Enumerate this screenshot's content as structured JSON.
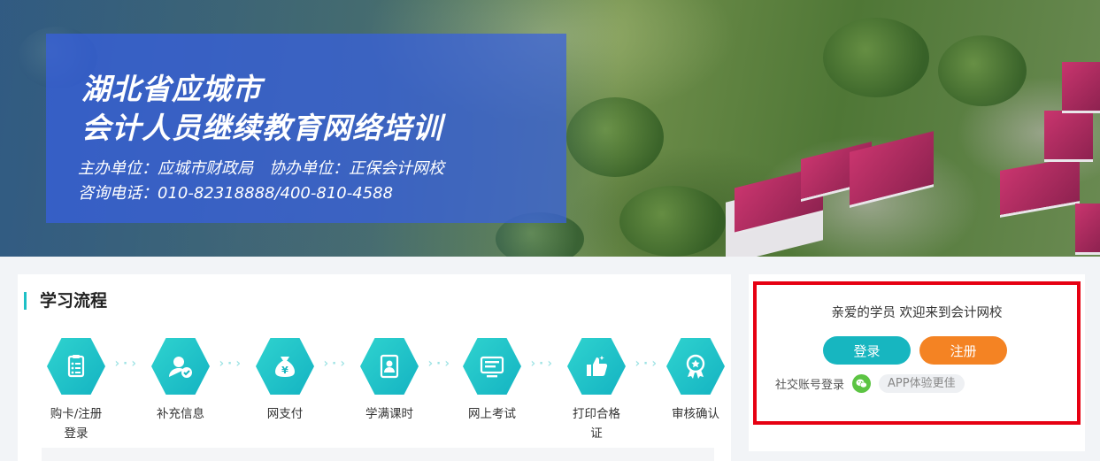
{
  "banner": {
    "title_line1": "湖北省应城市",
    "title_line2": "会计人员继续教育网络培训",
    "organizer": "主办单位：应城市财政局",
    "co_organizer": "协办单位：正保会计网校",
    "hotline": "咨询电话：010-82318888/400-810-4588"
  },
  "process": {
    "heading": "学习流程",
    "steps": [
      {
        "label": "购卡/注册登录",
        "icon": "card-list-icon"
      },
      {
        "label": "补充信息",
        "icon": "user-check-icon"
      },
      {
        "label": "网支付",
        "icon": "money-bag-icon"
      },
      {
        "label": "学满课时",
        "icon": "user-badge-icon"
      },
      {
        "label": "网上考试",
        "icon": "monitor-icon"
      },
      {
        "label": "打印合格证",
        "icon": "thumbs-up-icon"
      },
      {
        "label": "审核确认",
        "icon": "award-icon"
      }
    ],
    "arrow_glyph": "›·›"
  },
  "login": {
    "welcome": "亲爱的学员 欢迎来到会计网校",
    "login_button": "登录",
    "register_button": "注册",
    "social_label": "社交账号登录",
    "app_label": "APP体验更佳"
  },
  "colors": {
    "accent": "#17b6c0",
    "register": "#f48323",
    "highlight": "#e60012",
    "wechat": "#5cc443"
  }
}
